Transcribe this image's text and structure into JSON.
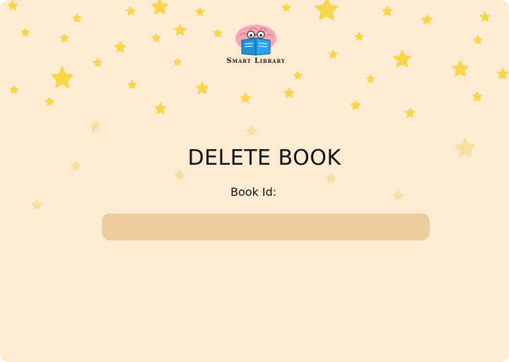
{
  "app": {
    "logo_text": "Smart Library",
    "logo_icon": "brain-reading-book-icon"
  },
  "page": {
    "title": "DELETE BOOK"
  },
  "form": {
    "book_id_label": "Book Id:",
    "book_id_value": "",
    "book_id_placeholder": ""
  },
  "colors": {
    "background": "#fdebd3",
    "input_fill": "#eecb9b",
    "star": "#f9d54a",
    "star_faded": "#f6dfa0"
  }
}
